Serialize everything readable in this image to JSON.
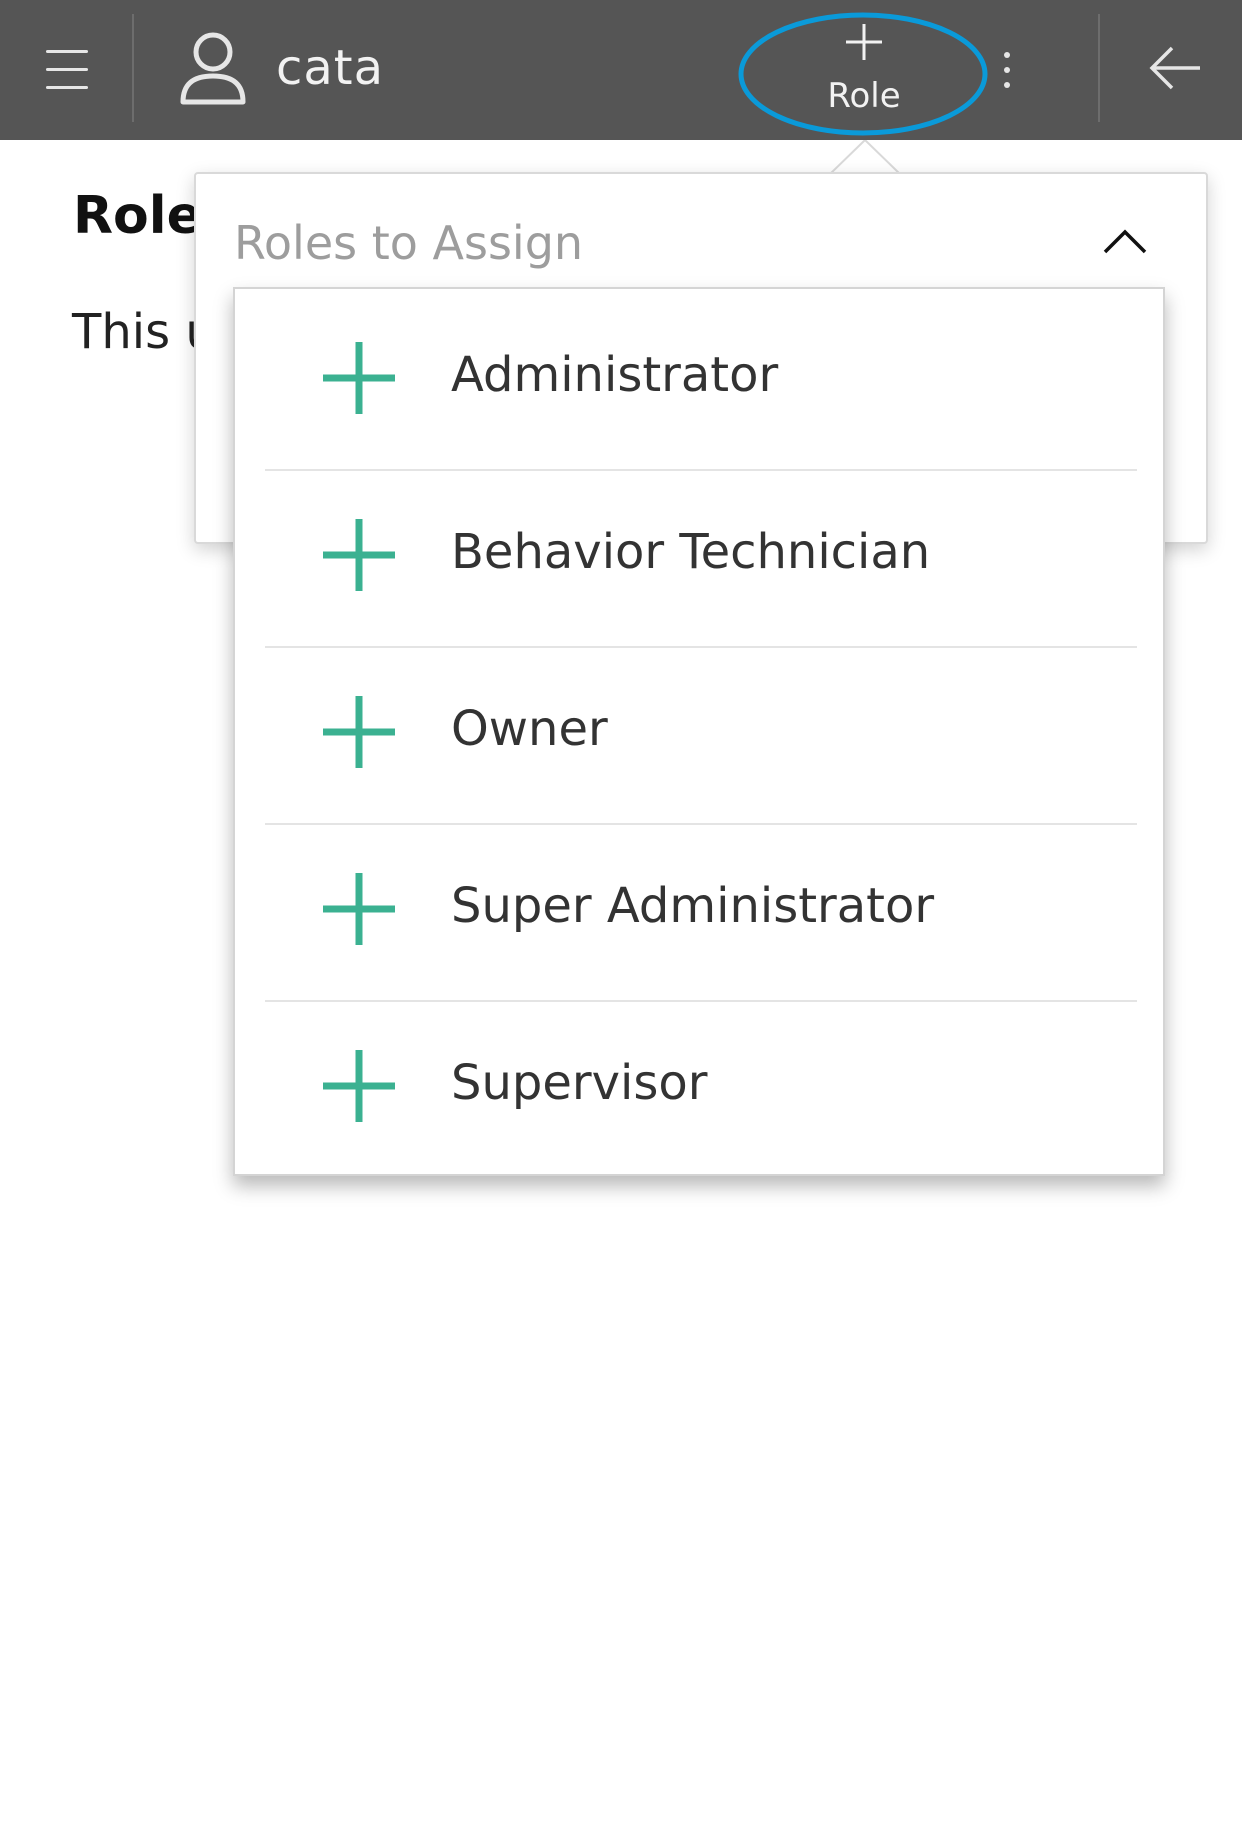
{
  "header": {
    "username": "cata",
    "add_role_label": "Role",
    "icons": [
      "menu-icon",
      "user-icon",
      "plus-icon",
      "more-vertical-icon",
      "arrow-left-icon"
    ],
    "bar_color": "#555555",
    "highlight_color": "#0a9ad9"
  },
  "page": {
    "heading": "Role",
    "body_text": "This u"
  },
  "roles_popover": {
    "placeholder": "Roles to Assign",
    "options": [
      {
        "label": "Administrator"
      },
      {
        "label": "Behavior Technician"
      },
      {
        "label": "Owner"
      },
      {
        "label": "Super Administrator"
      },
      {
        "label": "Supervisor"
      }
    ],
    "accent_color": "#3bb191"
  }
}
